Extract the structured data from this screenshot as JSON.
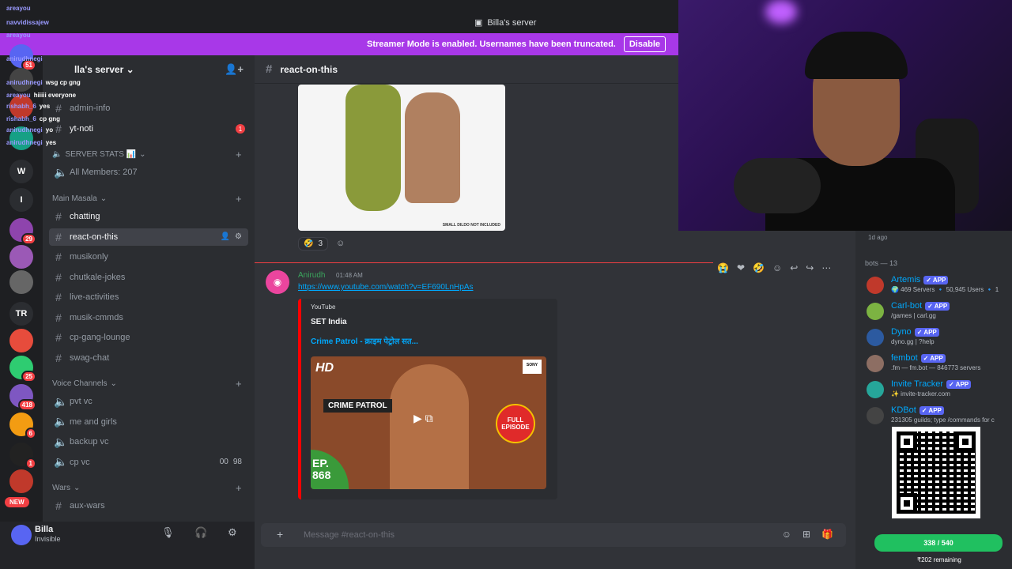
{
  "topbar": {
    "server_title": "Billa's server"
  },
  "streamer_banner": {
    "text": "Streamer Mode is enabled. Usernames have been truncated.",
    "button": "Disable"
  },
  "guilds": [
    {
      "label": "51",
      "color": "#5865f2"
    },
    {
      "label": "",
      "color": "#444"
    },
    {
      "label": "",
      "color": "#c0392b"
    },
    {
      "label": "",
      "color": "#16a085"
    },
    {
      "label": "W",
      "color": "#2b2d31"
    },
    {
      "label": "I",
      "color": "#2b2d31"
    },
    {
      "label": "29",
      "color": "#8e44ad"
    },
    {
      "label": "",
      "color": "#9b59b6"
    },
    {
      "label": "",
      "color": "#666"
    },
    {
      "label": "TR",
      "color": "#2b2d31"
    },
    {
      "label": "",
      "color": "#e74c3c"
    },
    {
      "label": "25",
      "color": "#2ecc71"
    },
    {
      "label": "418",
      "color": "#7e57c2"
    },
    {
      "label": "6",
      "color": "#f39c12"
    },
    {
      "label": "1",
      "color": "#222"
    },
    {
      "label": "",
      "color": "#c0392b"
    }
  ],
  "new_pill": "NEW",
  "sidebar": {
    "server_name": "lla's server",
    "channels_top": [
      {
        "label": "admin-info",
        "icon": "#"
      },
      {
        "label": "yt-noti",
        "icon": "#",
        "count": "1"
      }
    ],
    "server_stats_category": "SERVER STATS 📊",
    "all_members": "All Members: 207",
    "main_category": "Main Masala",
    "text_channels": [
      {
        "label": "chatting",
        "icon": "#",
        "bright": true
      },
      {
        "label": "react-on-this",
        "icon": "#",
        "active": true
      },
      {
        "label": "musikonly",
        "icon": "#"
      },
      {
        "label": "chutkale-jokes",
        "icon": "#"
      },
      {
        "label": "live-activities",
        "icon": "#"
      },
      {
        "label": "musik-cmmds",
        "icon": "#"
      },
      {
        "label": "cp-gang-lounge",
        "icon": "#"
      },
      {
        "label": "swag-chat",
        "icon": "#"
      }
    ],
    "voice_category": "Voice Channels",
    "voice_channels": [
      {
        "label": "pvt vc"
      },
      {
        "label": "me and girls"
      },
      {
        "label": "backup vc"
      },
      {
        "label": "cp vc",
        "counts": [
          "00",
          "98"
        ]
      }
    ],
    "wars_category": "Wars",
    "wars_channels": [
      {
        "label": "aux-wars"
      }
    ]
  },
  "user": {
    "name": "Billa",
    "status": "Invisible"
  },
  "chat": {
    "channel_name": "react-on-this",
    "image_caption": "SMALL DILDO NOT INCLUDED",
    "reaction": {
      "emoji": "🤣",
      "count": "3"
    },
    "message": {
      "author": "Anirudh",
      "time": "01:48 AM",
      "link": "https://www.youtube.com/watch?v=EF690LnHpAs",
      "embed": {
        "provider": "YouTube",
        "author": "SET India",
        "title": "Crime Patrol - क्राइम पेट्रोल सत...",
        "thumb_hd": "HD",
        "thumb_brand": "CRIME PATROL",
        "thumb_badge": "FULL EPISODE",
        "thumb_ep": "EP. 868",
        "thumb_sony": "SONY"
      }
    },
    "composer_placeholder": "Message #react-on-this"
  },
  "members": {
    "recent": "1d ago",
    "group": "bots — 13",
    "list": [
      {
        "name": "Artemis",
        "tag": "✓ APP",
        "sub": "🌍 469 Servers 🔹 50,945 Users 🔹 1",
        "color": "#c0392b"
      },
      {
        "name": "Carl-bot",
        "tag": "✓ APP",
        "sub": "/games | carl.gg",
        "color": "#7cb342"
      },
      {
        "name": "Dyno",
        "tag": "✓ APP",
        "sub": "dyno.gg | ?help",
        "color": "#2c5aa0"
      },
      {
        "name": "fembot",
        "tag": "✓ APP",
        "sub": ".fm — fm.bot — 846773 servers",
        "color": "#8d6e63"
      },
      {
        "name": "Invite Tracker",
        "tag": "✓ APP",
        "sub": "✨ invite-tracker.com",
        "color": "#26a69a"
      },
      {
        "name": "KDBot",
        "tag": "✓ APP",
        "sub": "231305 guilds; type /commands for c",
        "color": "#444"
      }
    ]
  },
  "goal": {
    "label": "338 / 540",
    "remaining": "₹202 remaining"
  },
  "chat_overlay": [
    {
      "user": "areayou",
      "msg": ""
    },
    {
      "user": "navvidissajew",
      "msg": ""
    },
    {
      "user": "areayou",
      "msg": ""
    },
    {
      "user": "anirudhnegi",
      "msg": ""
    },
    {
      "user": "anirudhnegi",
      "msg": "wsg cp gng"
    },
    {
      "user": "areayou",
      "msg": "hiiiii everyone"
    },
    {
      "user": "rishabh_6",
      "msg": "yes"
    },
    {
      "user": "rishabh_6",
      "msg": "cp gng"
    },
    {
      "user": "anirudhnegi",
      "msg": "yo"
    },
    {
      "user": "anirudhnegi",
      "msg": "yes"
    }
  ]
}
